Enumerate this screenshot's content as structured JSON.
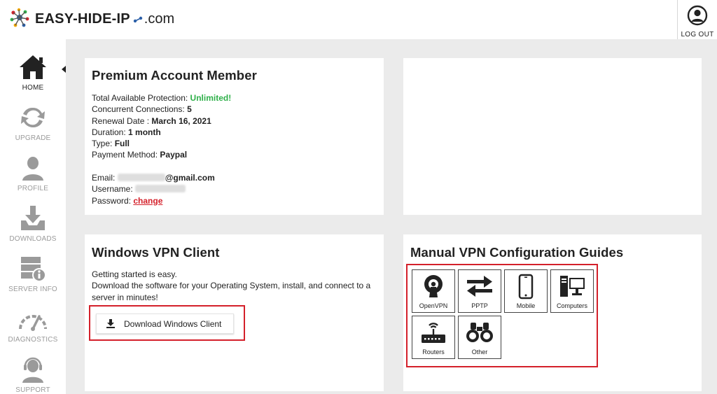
{
  "header": {
    "logo_text": "EASY-HIDE-IP",
    "logo_suffix": ".com",
    "logout_label": "LOG OUT"
  },
  "sidebar": {
    "items": [
      {
        "label": "HOME",
        "icon": "home-icon",
        "active": true
      },
      {
        "label": "UPGRADE",
        "icon": "refresh-icon",
        "active": false
      },
      {
        "label": "PROFILE",
        "icon": "user-icon",
        "active": false
      },
      {
        "label": "DOWNLOADS",
        "icon": "download-tray-icon",
        "active": false
      },
      {
        "label": "SERVER INFO",
        "icon": "server-info-icon",
        "active": false
      },
      {
        "label": "DIAGNOSTICS",
        "icon": "gauge-icon",
        "active": false
      },
      {
        "label": "SUPPORT",
        "icon": "headset-icon",
        "active": false
      }
    ]
  },
  "account": {
    "title": "Premium Account Member",
    "protection_label": "Total Available Protection: ",
    "protection_value": "Unlimited!",
    "connections_label": "Concurrent Connections: ",
    "connections_value": "5",
    "renewal_label": "Renewal Date : ",
    "renewal_value": "March 16, 2021",
    "duration_label": "Duration: ",
    "duration_value": "1 month",
    "type_label": "Type: ",
    "type_value": "Full",
    "payment_label": "Payment Method: ",
    "payment_value": "Paypal",
    "email_label": "Email: ",
    "email_domain": "@gmail.com",
    "username_label": "Username: ",
    "password_label": "Password: ",
    "password_link": "change"
  },
  "windows_client": {
    "title": "Windows VPN Client",
    "line1": "Getting started is easy.",
    "line2": "Download the software for your Operating System, install, and connect to a server in minutes!",
    "download_label": "Download Windows Client"
  },
  "guides": {
    "title": "Manual VPN Configuration Guides",
    "items": [
      {
        "label": "OpenVPN",
        "icon": "openvpn-icon"
      },
      {
        "label": "PPTP",
        "icon": "swap-arrows-icon"
      },
      {
        "label": "Mobile",
        "icon": "mobile-icon"
      },
      {
        "label": "Computers",
        "icon": "computer-icon"
      },
      {
        "label": "Routers",
        "icon": "router-icon"
      },
      {
        "label": "Other",
        "icon": "binoculars-icon"
      }
    ]
  },
  "colors": {
    "accent_red": "#d4202a",
    "unlimited_green": "#2fb04a",
    "background": "#ebebeb"
  }
}
